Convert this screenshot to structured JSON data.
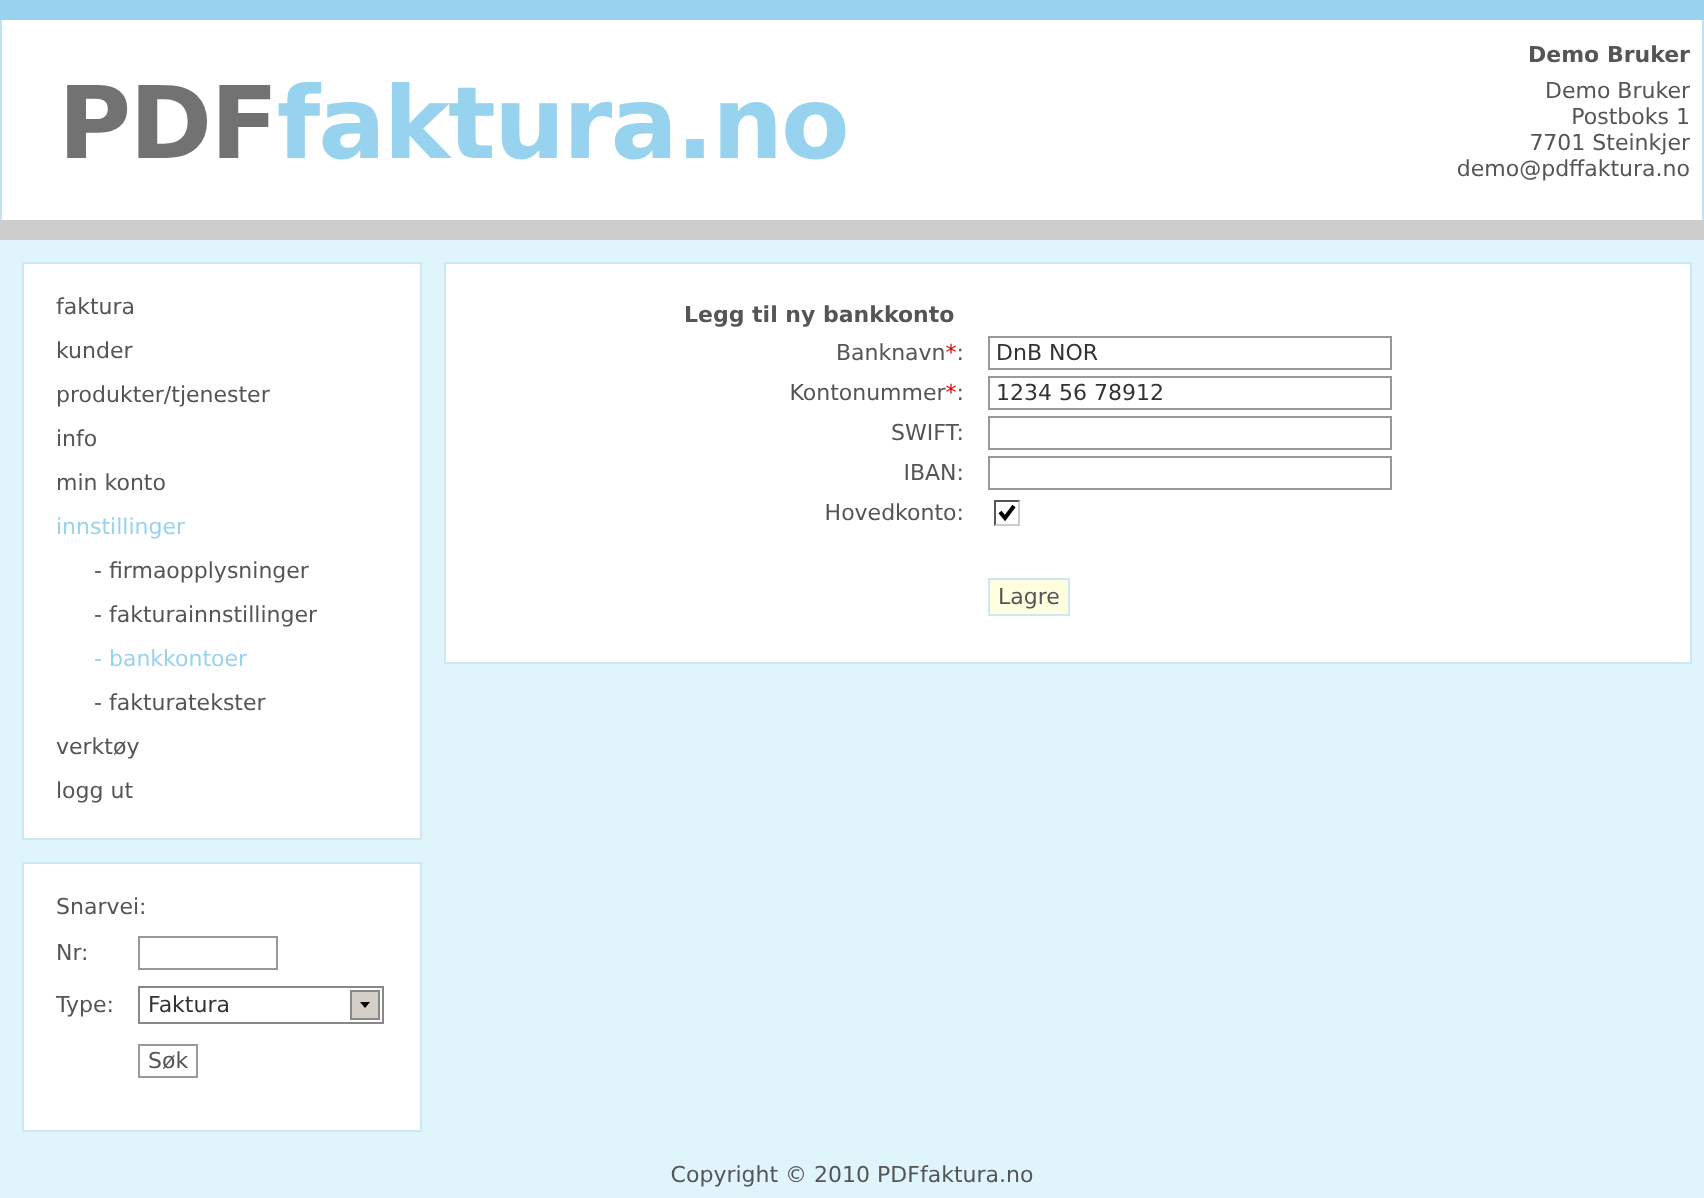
{
  "header": {
    "logo": {
      "prefix": "PDF",
      "suffix": "faktura.no"
    },
    "user": {
      "name": "Demo Bruker",
      "address": [
        "Demo Bruker",
        "Postboks 1",
        "7701 Steinkjer",
        "demo@pdffaktura.no"
      ]
    }
  },
  "menu": [
    {
      "label": "faktura",
      "kind": "top",
      "selected": false
    },
    {
      "label": "kunder",
      "kind": "top",
      "selected": false
    },
    {
      "label": "produkter/tjenester",
      "kind": "top",
      "selected": false
    },
    {
      "label": "info",
      "kind": "top",
      "selected": false
    },
    {
      "label": "min konto",
      "kind": "top",
      "selected": false
    },
    {
      "label": "innstillinger",
      "kind": "top",
      "selected": true
    },
    {
      "label": "- firmaopplysninger",
      "kind": "sub",
      "selected": false
    },
    {
      "label": "- fakturainnstillinger",
      "kind": "sub",
      "selected": false
    },
    {
      "label": "- bankkontoer",
      "kind": "sub",
      "selected": true
    },
    {
      "label": "- fakturatekster",
      "kind": "sub",
      "selected": false
    },
    {
      "label": "verktøy",
      "kind": "top",
      "selected": false
    },
    {
      "label": "logg ut",
      "kind": "top",
      "selected": false
    }
  ],
  "shortcut": {
    "title": "Snarvei:",
    "nr_label": "Nr:",
    "type_label": "Type:",
    "type_value": "Faktura",
    "button": "Søk"
  },
  "form": {
    "title": "Legg til ny bankkonto",
    "fields": [
      {
        "kind": "text",
        "label": "Banknavn",
        "required_mark": "*",
        "colon": ":",
        "value": "DnB NOR"
      },
      {
        "kind": "text",
        "label": "Kontonummer",
        "required_mark": "*",
        "colon": ":",
        "value": "1234 56 78912"
      },
      {
        "kind": "text",
        "label": "SWIFT",
        "colon": ":"
      },
      {
        "kind": "text",
        "label": "IBAN",
        "colon": ":"
      },
      {
        "kind": "checkbox",
        "label": "Hovedkonto",
        "colon": ":",
        "checked": true
      }
    ],
    "button": "Lagre"
  },
  "footer": "Copyright © 2010 PDFfaktura.no"
}
